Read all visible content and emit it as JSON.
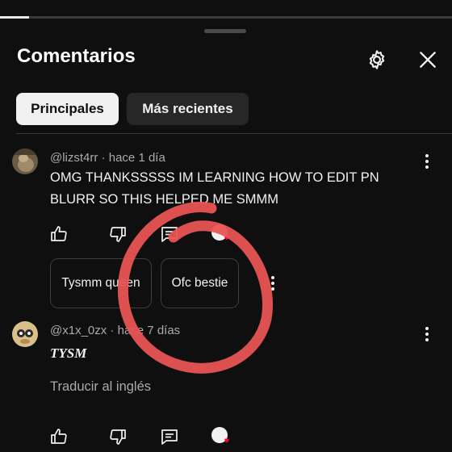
{
  "player": {
    "progress_fraction": 0.065
  },
  "panel": {
    "title": "Comentarios",
    "tabs": [
      {
        "label": "Principales",
        "active": true
      },
      {
        "label": "Más recientes",
        "active": false
      }
    ]
  },
  "comments": [
    {
      "author": "@lizst4rr",
      "time": "hace 1 día",
      "text_line1": "OMG THANKSSSSS IM LEARNING HOW TO EDIT PN",
      "text_line2": "BLURR SO THIS HELPED ME SMMM",
      "replies": [
        "Tysmm queen",
        "Ofc bestie"
      ]
    },
    {
      "author": "@x1x_0zx",
      "time": "hace 7 días",
      "text": "TYSM",
      "translate": "Traducir al inglés"
    }
  ],
  "icons": {
    "settings": "gear-icon",
    "close": "close-icon",
    "like": "thumb-up-icon",
    "dislike": "thumb-down-icon",
    "reply": "reply-icon",
    "creator_heart": "creator-heart-icon",
    "more": "more-vert-icon"
  },
  "colors": {
    "annotation_circle": "#e85454",
    "heart": "#ff0033"
  }
}
